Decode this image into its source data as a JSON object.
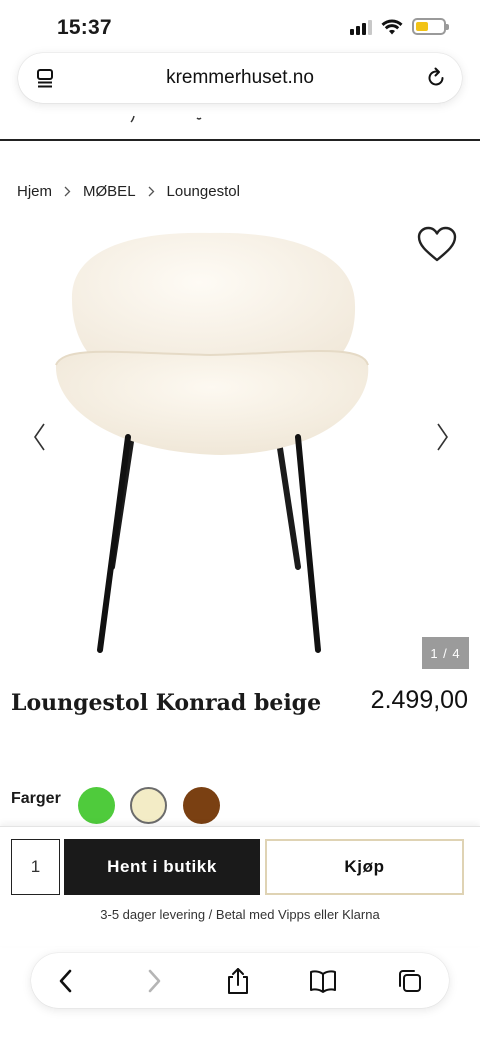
{
  "status": {
    "time": "15:37"
  },
  "browser": {
    "url": "kremmerhuset.no"
  },
  "breadcrumb": [
    "Hjem",
    "MØBEL",
    "Loungestol"
  ],
  "gallery": {
    "counter": "1 / 4"
  },
  "product": {
    "title": "Loungestol Konrad beige",
    "price": "2.499,00"
  },
  "colors": {
    "label": "Farger",
    "swatches": [
      {
        "name": "green",
        "hex": "#4fcb3c"
      },
      {
        "name": "cream",
        "hex": "#f3ecc6"
      },
      {
        "name": "brown",
        "hex": "#7a4012"
      }
    ]
  },
  "purchase": {
    "quantity": "1",
    "pickup_label": "Hent i butikk",
    "buy_label": "Kjøp",
    "delivery_note": "3-5 dager levering / Betal med Vipps eller Klarna"
  },
  "icons": {
    "tabs": "tabs-icon",
    "reload": "reload-icon",
    "heart": "heart-icon",
    "prev": "chevron-left-icon",
    "next": "chevron-right-icon",
    "back": "back-icon",
    "forward": "forward-icon",
    "share": "share-icon",
    "bookmarks": "book-icon",
    "pages": "pages-icon"
  }
}
